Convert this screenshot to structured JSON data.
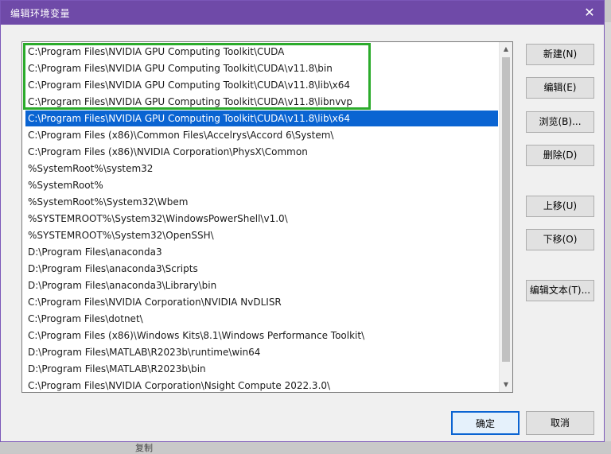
{
  "window": {
    "title": "编辑环境变量",
    "close_glyph": "✕"
  },
  "list": {
    "items": [
      "C:\\Program Files\\NVIDIA GPU Computing Toolkit\\CUDA",
      "C:\\Program Files\\NVIDIA GPU Computing Toolkit\\CUDA\\v11.8\\bin",
      "C:\\Program Files\\NVIDIA GPU Computing Toolkit\\CUDA\\v11.8\\lib\\x64",
      "C:\\Program Files\\NVIDIA GPU Computing Toolkit\\CUDA\\v11.8\\libnvvp",
      "C:\\Program Files\\NVIDIA GPU Computing Toolkit\\CUDA\\v11.8\\lib\\x64",
      "C:\\Program Files (x86)\\Common Files\\Accelrys\\Accord 6\\System\\",
      "C:\\Program Files (x86)\\NVIDIA Corporation\\PhysX\\Common",
      "%SystemRoot%\\system32",
      "%SystemRoot%",
      "%SystemRoot%\\System32\\Wbem",
      "%SYSTEMROOT%\\System32\\WindowsPowerShell\\v1.0\\",
      "%SYSTEMROOT%\\System32\\OpenSSH\\",
      "D:\\Program Files\\anaconda3",
      "D:\\Program Files\\anaconda3\\Scripts",
      "D:\\Program Files\\anaconda3\\Library\\bin",
      "C:\\Program Files\\NVIDIA Corporation\\NVIDIA NvDLISR",
      "C:\\Program Files\\dotnet\\",
      "C:\\Program Files (x86)\\Windows Kits\\8.1\\Windows Performance Toolkit\\",
      "D:\\Program Files\\MATLAB\\R2023b\\runtime\\win64",
      "D:\\Program Files\\MATLAB\\R2023b\\bin",
      "C:\\Program Files\\NVIDIA Corporation\\Nsight Compute 2022.3.0\\"
    ],
    "selected_index": 4,
    "highlight_color": "#2bab2b",
    "selection_color": "#0a64d2"
  },
  "buttons": {
    "new": "新建(N)",
    "edit": "编辑(E)",
    "browse": "浏览(B)...",
    "delete": "删除(D)",
    "move_up": "上移(U)",
    "move_down": "下移(O)",
    "edit_text": "编辑文本(T)...",
    "ok": "确定",
    "cancel": "取消"
  },
  "background": {
    "fragment_text": "复制"
  }
}
